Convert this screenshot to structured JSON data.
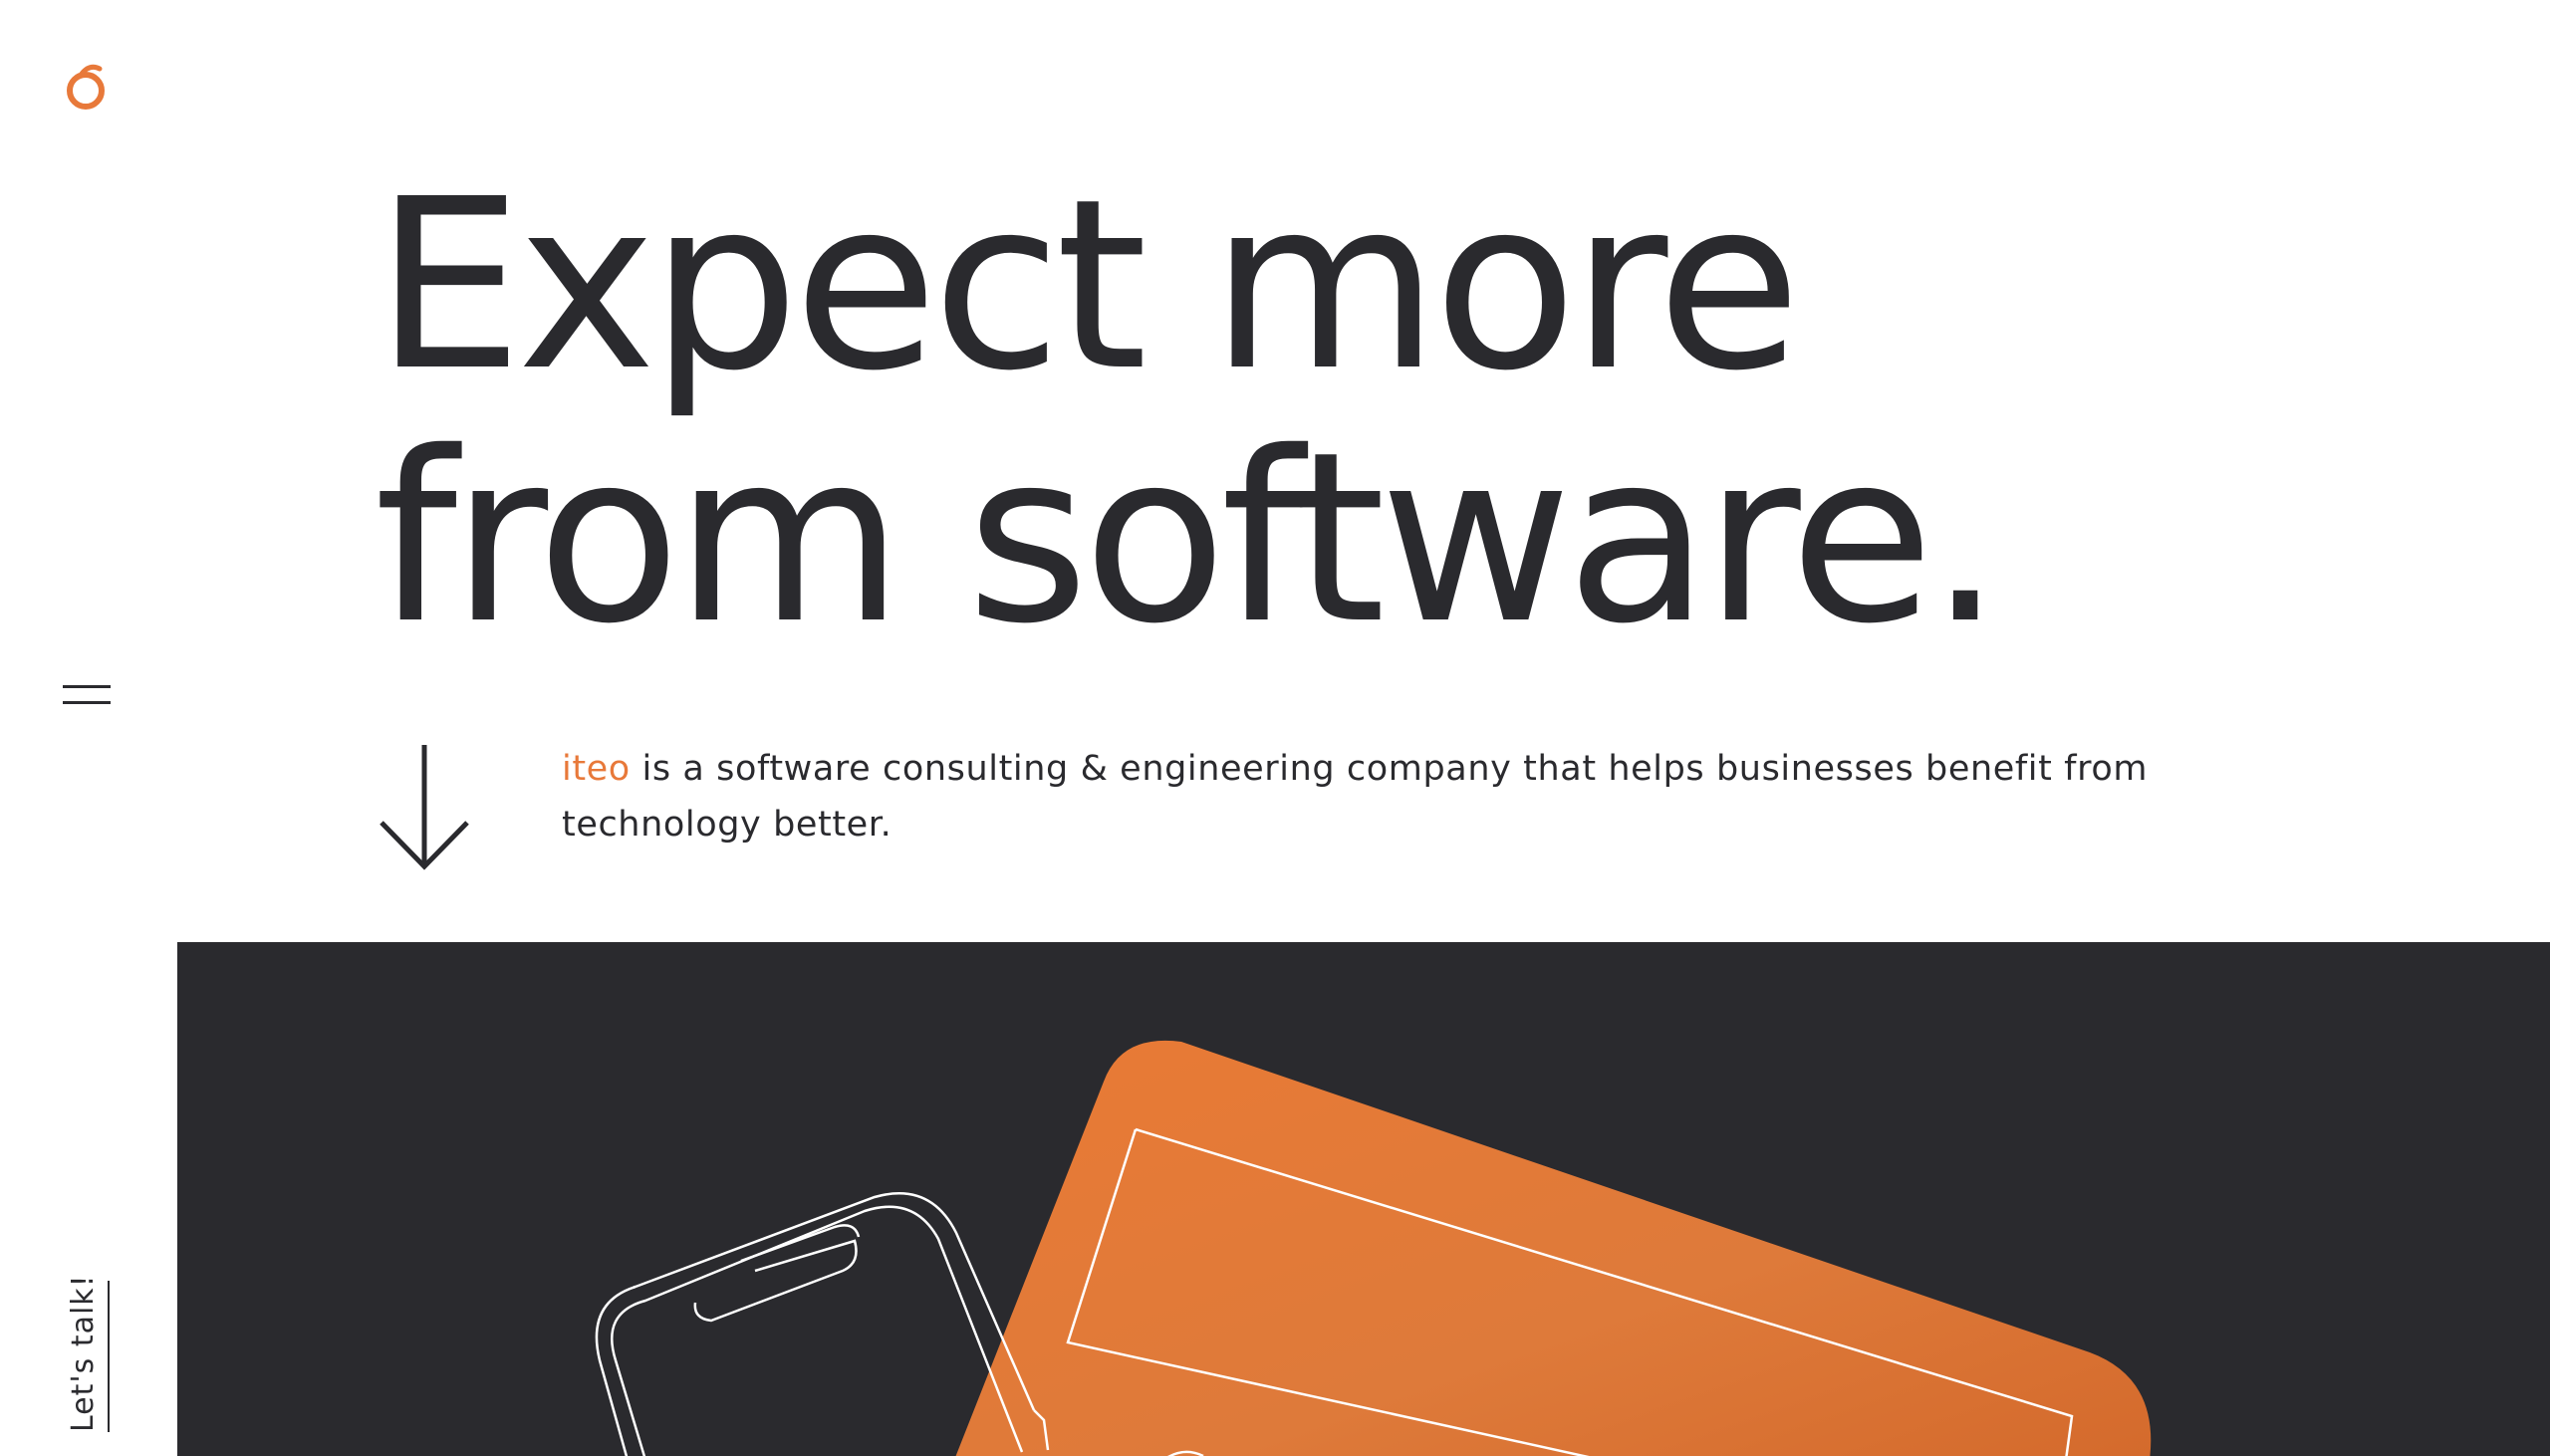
{
  "brand": {
    "logo_icon": "iteo-logo-icon",
    "accent_color": "#e8793a",
    "text_color": "#2a2a2e",
    "panel_color": "#2a2a2e"
  },
  "nav": {
    "menu_icon": "hamburger-menu-icon",
    "cta_label": "Let's talk!"
  },
  "hero": {
    "headline_line1": "Expect more",
    "headline_line2": "from software.",
    "scroll_icon": "arrow-down-icon",
    "intro_brand": "iteo",
    "intro_text": " is a software consulting & engineering company that helps businesses benefit from technology better.",
    "illustration": "phone-outline-and-orange-tablet-illustration"
  }
}
